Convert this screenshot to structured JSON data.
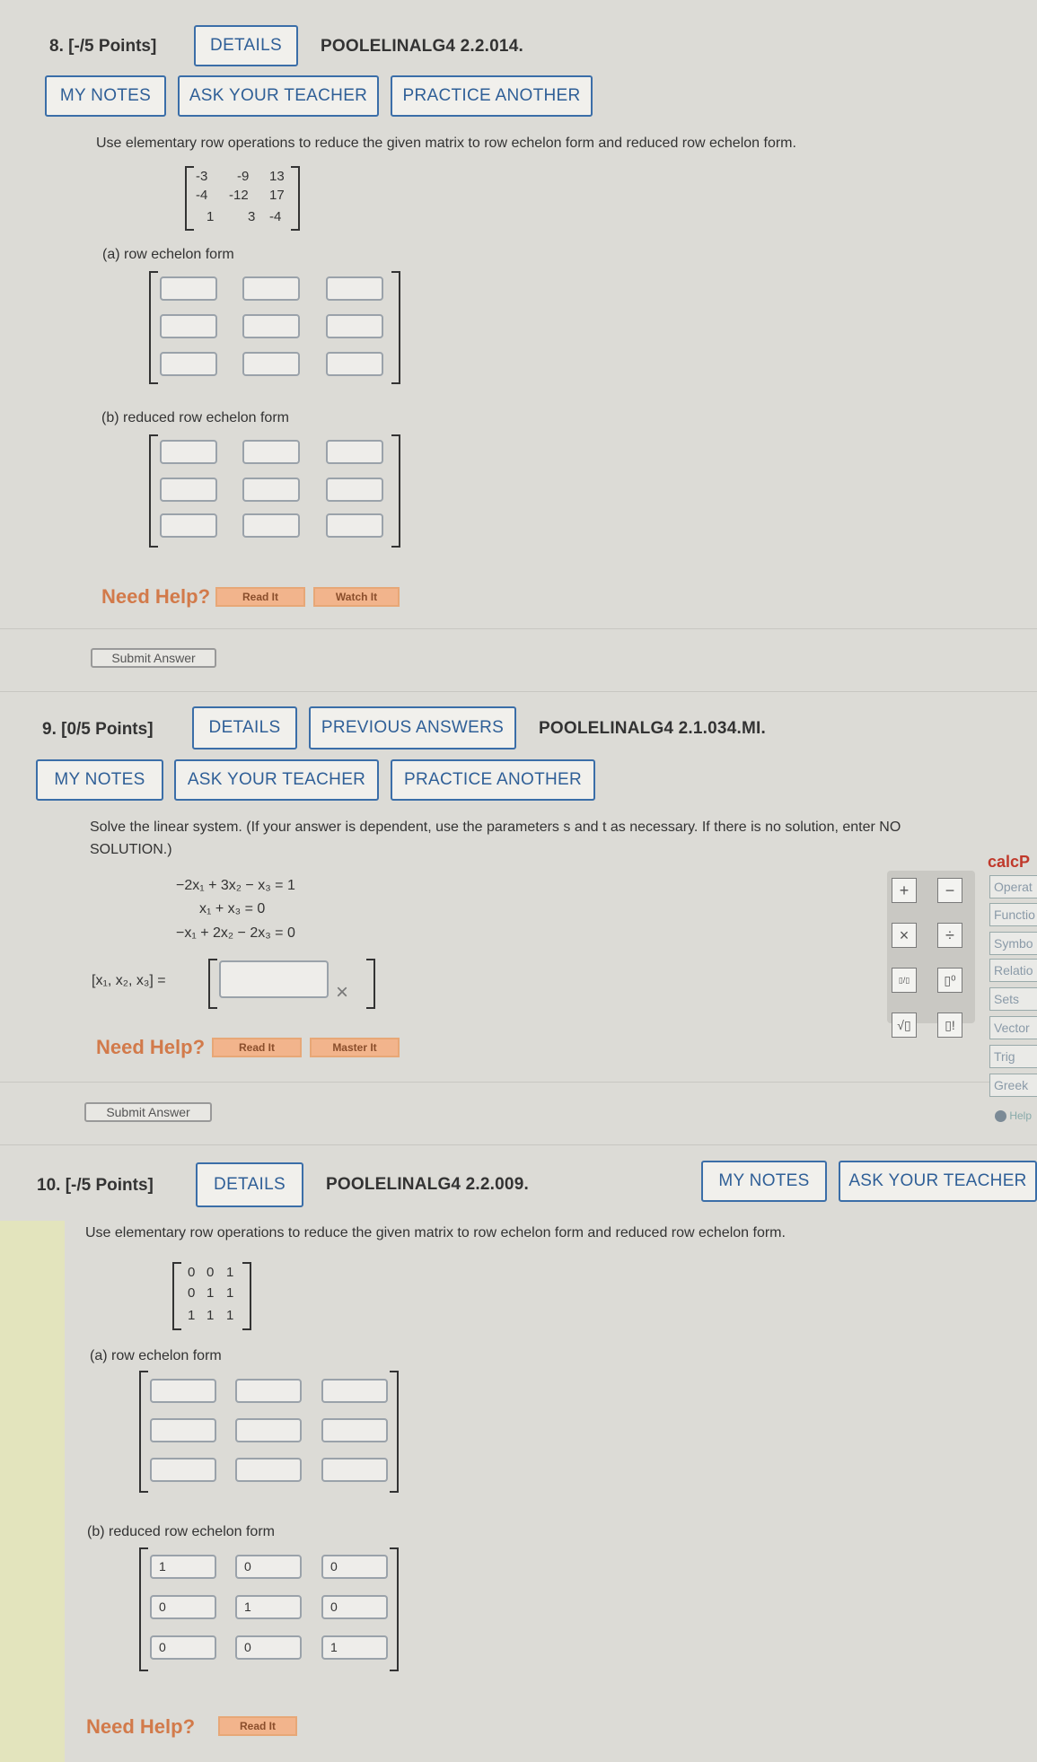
{
  "q8": {
    "header": "8. [-/5 Points]",
    "details": "DETAILS",
    "code": "POOLELINALG4 2.2.014.",
    "my_notes": "MY NOTES",
    "ask_teacher": "ASK YOUR TEACHER",
    "practice": "PRACTICE ANOTHER",
    "prompt": "Use elementary row operations to reduce the given matrix to row echelon form and reduced row echelon form.",
    "matrix": [
      [
        "-3",
        "-9",
        "13"
      ],
      [
        "-4",
        "-12",
        "17"
      ],
      [
        "1",
        "3",
        "-4"
      ]
    ],
    "part_a": "(a)  row echelon form",
    "part_b": "(b)  reduced row echelon form",
    "need_help": "Need Help?",
    "read_it": "Read It",
    "watch_it": "Watch It",
    "submit": "Submit Answer"
  },
  "q9": {
    "header": "9. [0/5 Points]",
    "details": "DETAILS",
    "previous": "PREVIOUS ANSWERS",
    "code": "POOLELINALG4 2.1.034.MI.",
    "my_notes": "MY NOTES",
    "ask_teacher": "ASK YOUR TEACHER",
    "practice": "PRACTICE ANOTHER",
    "prompt_line1": "Solve the linear system. (If your answer is dependent, use the parameters s and t as necessary. If there is no solution, enter NO",
    "prompt_line2": "SOLUTION.)",
    "eq1": "−2x₁ + 3x₂ −   x₃ = 1",
    "eq2": "x₁             +   x₃ = 0",
    "eq3": "−x₁ + 2x₂ − 2x₃ = 0",
    "answer_label": "[x₁, x₂, x₃] =",
    "answer_value": "",
    "wrong_mark": "×",
    "need_help": "Need Help?",
    "read_it": "Read It",
    "master_it": "Master It",
    "submit": "Submit Answer"
  },
  "calc": {
    "title": "calcP",
    "plus": "+",
    "minus": "−",
    "times": "×",
    "divide": "÷",
    "fraction": "▯/▯",
    "power": "▯⁰",
    "sqrt": "√▯",
    "factorial": "▯!",
    "tabs": [
      "Operat",
      "Functio",
      "Symbo",
      "Relatio",
      "Sets",
      "Vector",
      "Trig",
      "Greek"
    ],
    "help": "Help"
  },
  "q10": {
    "header": "10. [-/5 Points]",
    "details": "DETAILS",
    "code": "POOLELINALG4 2.2.009.",
    "my_notes": "MY NOTES",
    "ask_teacher": "ASK YOUR TEACHER",
    "prompt": "Use elementary row operations to reduce the given matrix to row echelon form and reduced row echelon form.",
    "matrix": [
      [
        "0",
        "0",
        "1"
      ],
      [
        "0",
        "1",
        "1"
      ],
      [
        "1",
        "1",
        "1"
      ]
    ],
    "part_a": "(a)  row echelon form",
    "part_b": "(b)  reduced row echelon form",
    "rref": [
      [
        "1",
        "0",
        "0"
      ],
      [
        "0",
        "1",
        "0"
      ],
      [
        "0",
        "0",
        "1"
      ]
    ],
    "need_help": "Need Help?",
    "read_it": "Read It"
  }
}
